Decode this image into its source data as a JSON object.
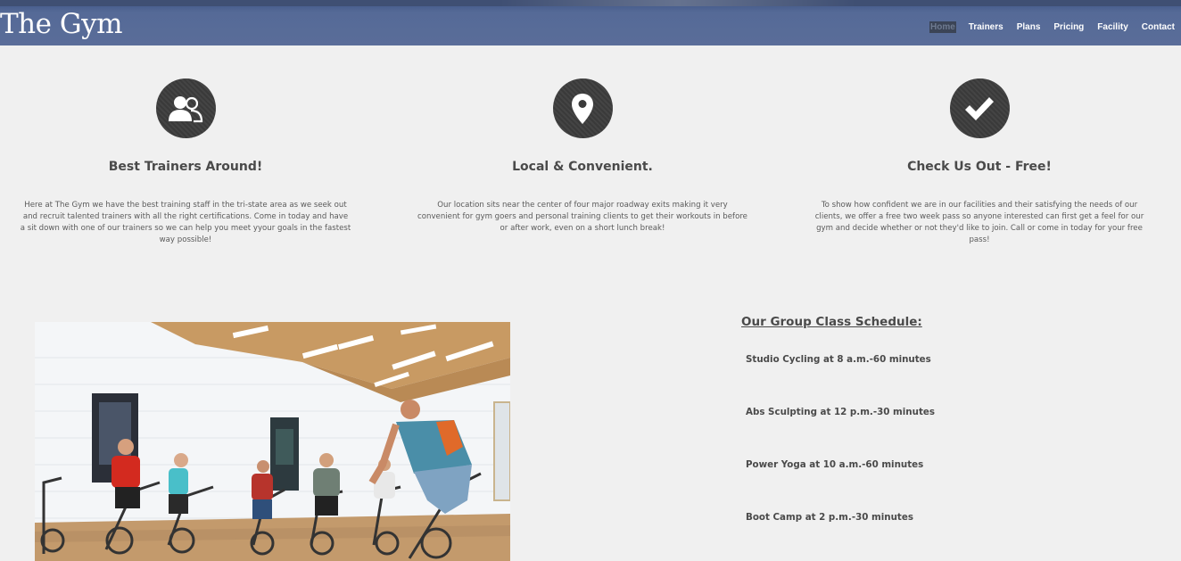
{
  "header": {
    "logo": "The Gym",
    "nav": [
      {
        "label": "Home",
        "active": true
      },
      {
        "label": "Trainers"
      },
      {
        "label": "Plans"
      },
      {
        "label": "Pricing"
      },
      {
        "label": "Facility"
      },
      {
        "label": "Contact"
      }
    ]
  },
  "features": [
    {
      "icon": "users-icon",
      "title": "Best Trainers Around!",
      "text": "Here at The Gym we have the best training staff in the tri-state area as we seek out and recruit talented trainers with all the right certifications. Come in today and have a sit down with one of our trainers so we can help you meet yyour goals in the fastest way possible!"
    },
    {
      "icon": "map-pin-icon",
      "title": "Local & Convenient.",
      "text": "Our location sits near the center of four major roadway exits making it very convenient for gym goers and personal training clients to get their workouts in before or after work, even on a short lunch break!"
    },
    {
      "icon": "checkmark-icon",
      "title": "Check Us Out - Free!",
      "text": "To show how confident we are in our facilities and their satisfying the needs of our clients, we offer a free two week pass so anyone interested can first get a feel for our gym and decide whether or not they'd like to join. Call or come in today for your free pass!"
    }
  ],
  "schedule": {
    "title": "Our Group Class Schedule:",
    "items": [
      "Studio Cycling at 8 a.m.-60 minutes",
      "Abs Sculpting at 12 p.m.-30 minutes",
      "Power Yoga at 10 a.m.-60 minutes",
      "Boot Camp at 2 p.m.-30 minutes"
    ]
  },
  "colors": {
    "header_bg": "#556a97",
    "page_bg": "#f0f0f0",
    "icon_circle": "#3a3a3a"
  }
}
